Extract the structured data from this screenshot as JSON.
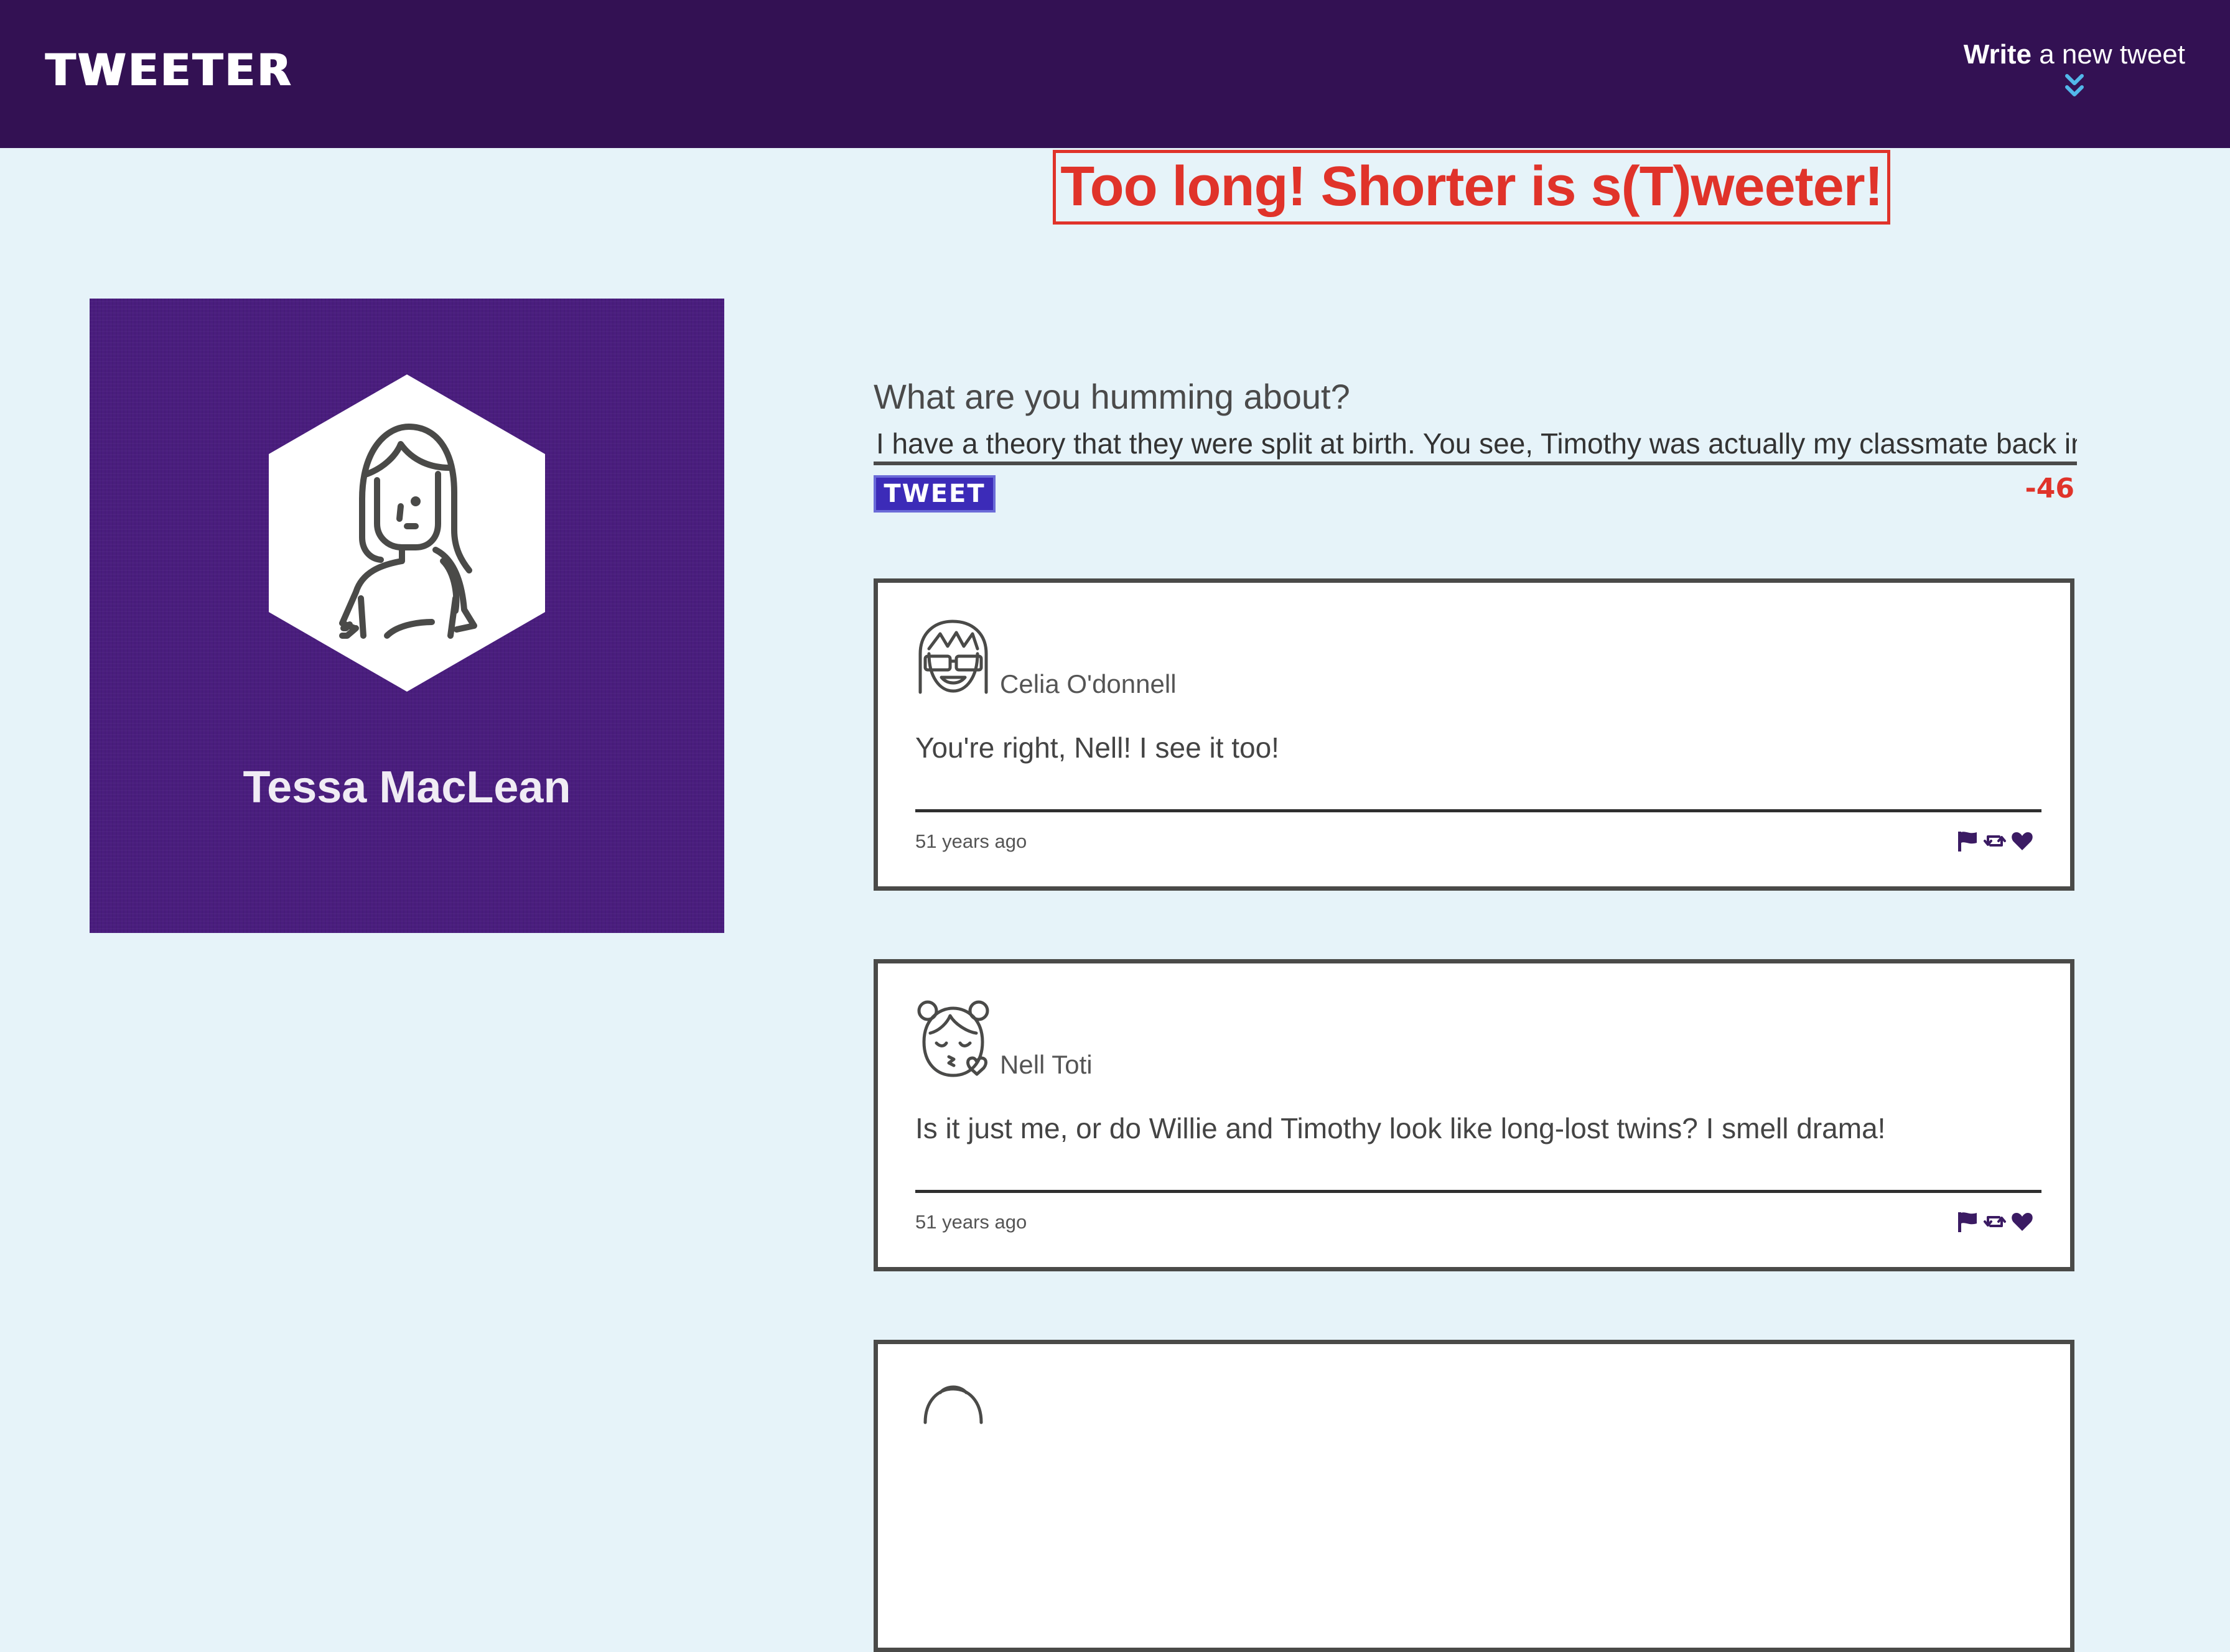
{
  "nav": {
    "brand": "TWEETER",
    "compose_bold": "Write",
    "compose_rest": " a new tweet",
    "compose_icon": "double-chevron-down-icon",
    "compose_icon_color": "#52b7ea"
  },
  "error": {
    "message": "Too long! Shorter is s(T)weeter!"
  },
  "profile": {
    "name": "Tessa MacLean",
    "avatar_icon": "woman-avatar-icon"
  },
  "composer": {
    "prompt": "What are you humming about?",
    "value": "I have a theory that they were split at birth. You see, Timothy was actually my classmate back in",
    "submit_label": "TWEET",
    "counter": "-46"
  },
  "tweets": [
    {
      "author": "Celia O'donnell",
      "avatar_icon": "girl-sunglasses-avatar-icon",
      "text": "You're right, Nell! I see it too!",
      "time": "51 years ago"
    },
    {
      "author": "Nell Toti",
      "avatar_icon": "girl-kiss-avatar-icon",
      "text": "Is it just me, or do Willie and Timothy look like long-lost twins? I smell drama!",
      "time": "51 years ago"
    },
    {
      "author": "",
      "avatar_icon": "avatar-icon",
      "text": "",
      "time": ""
    }
  ],
  "colors": {
    "nav_bg": "#331153",
    "page_bg": "#e6f3f9",
    "profile_bg": "#4a1d7e",
    "error": "#e0332a",
    "tweet_button": "#3c2bb8",
    "action_icons": "#3b1b63"
  }
}
